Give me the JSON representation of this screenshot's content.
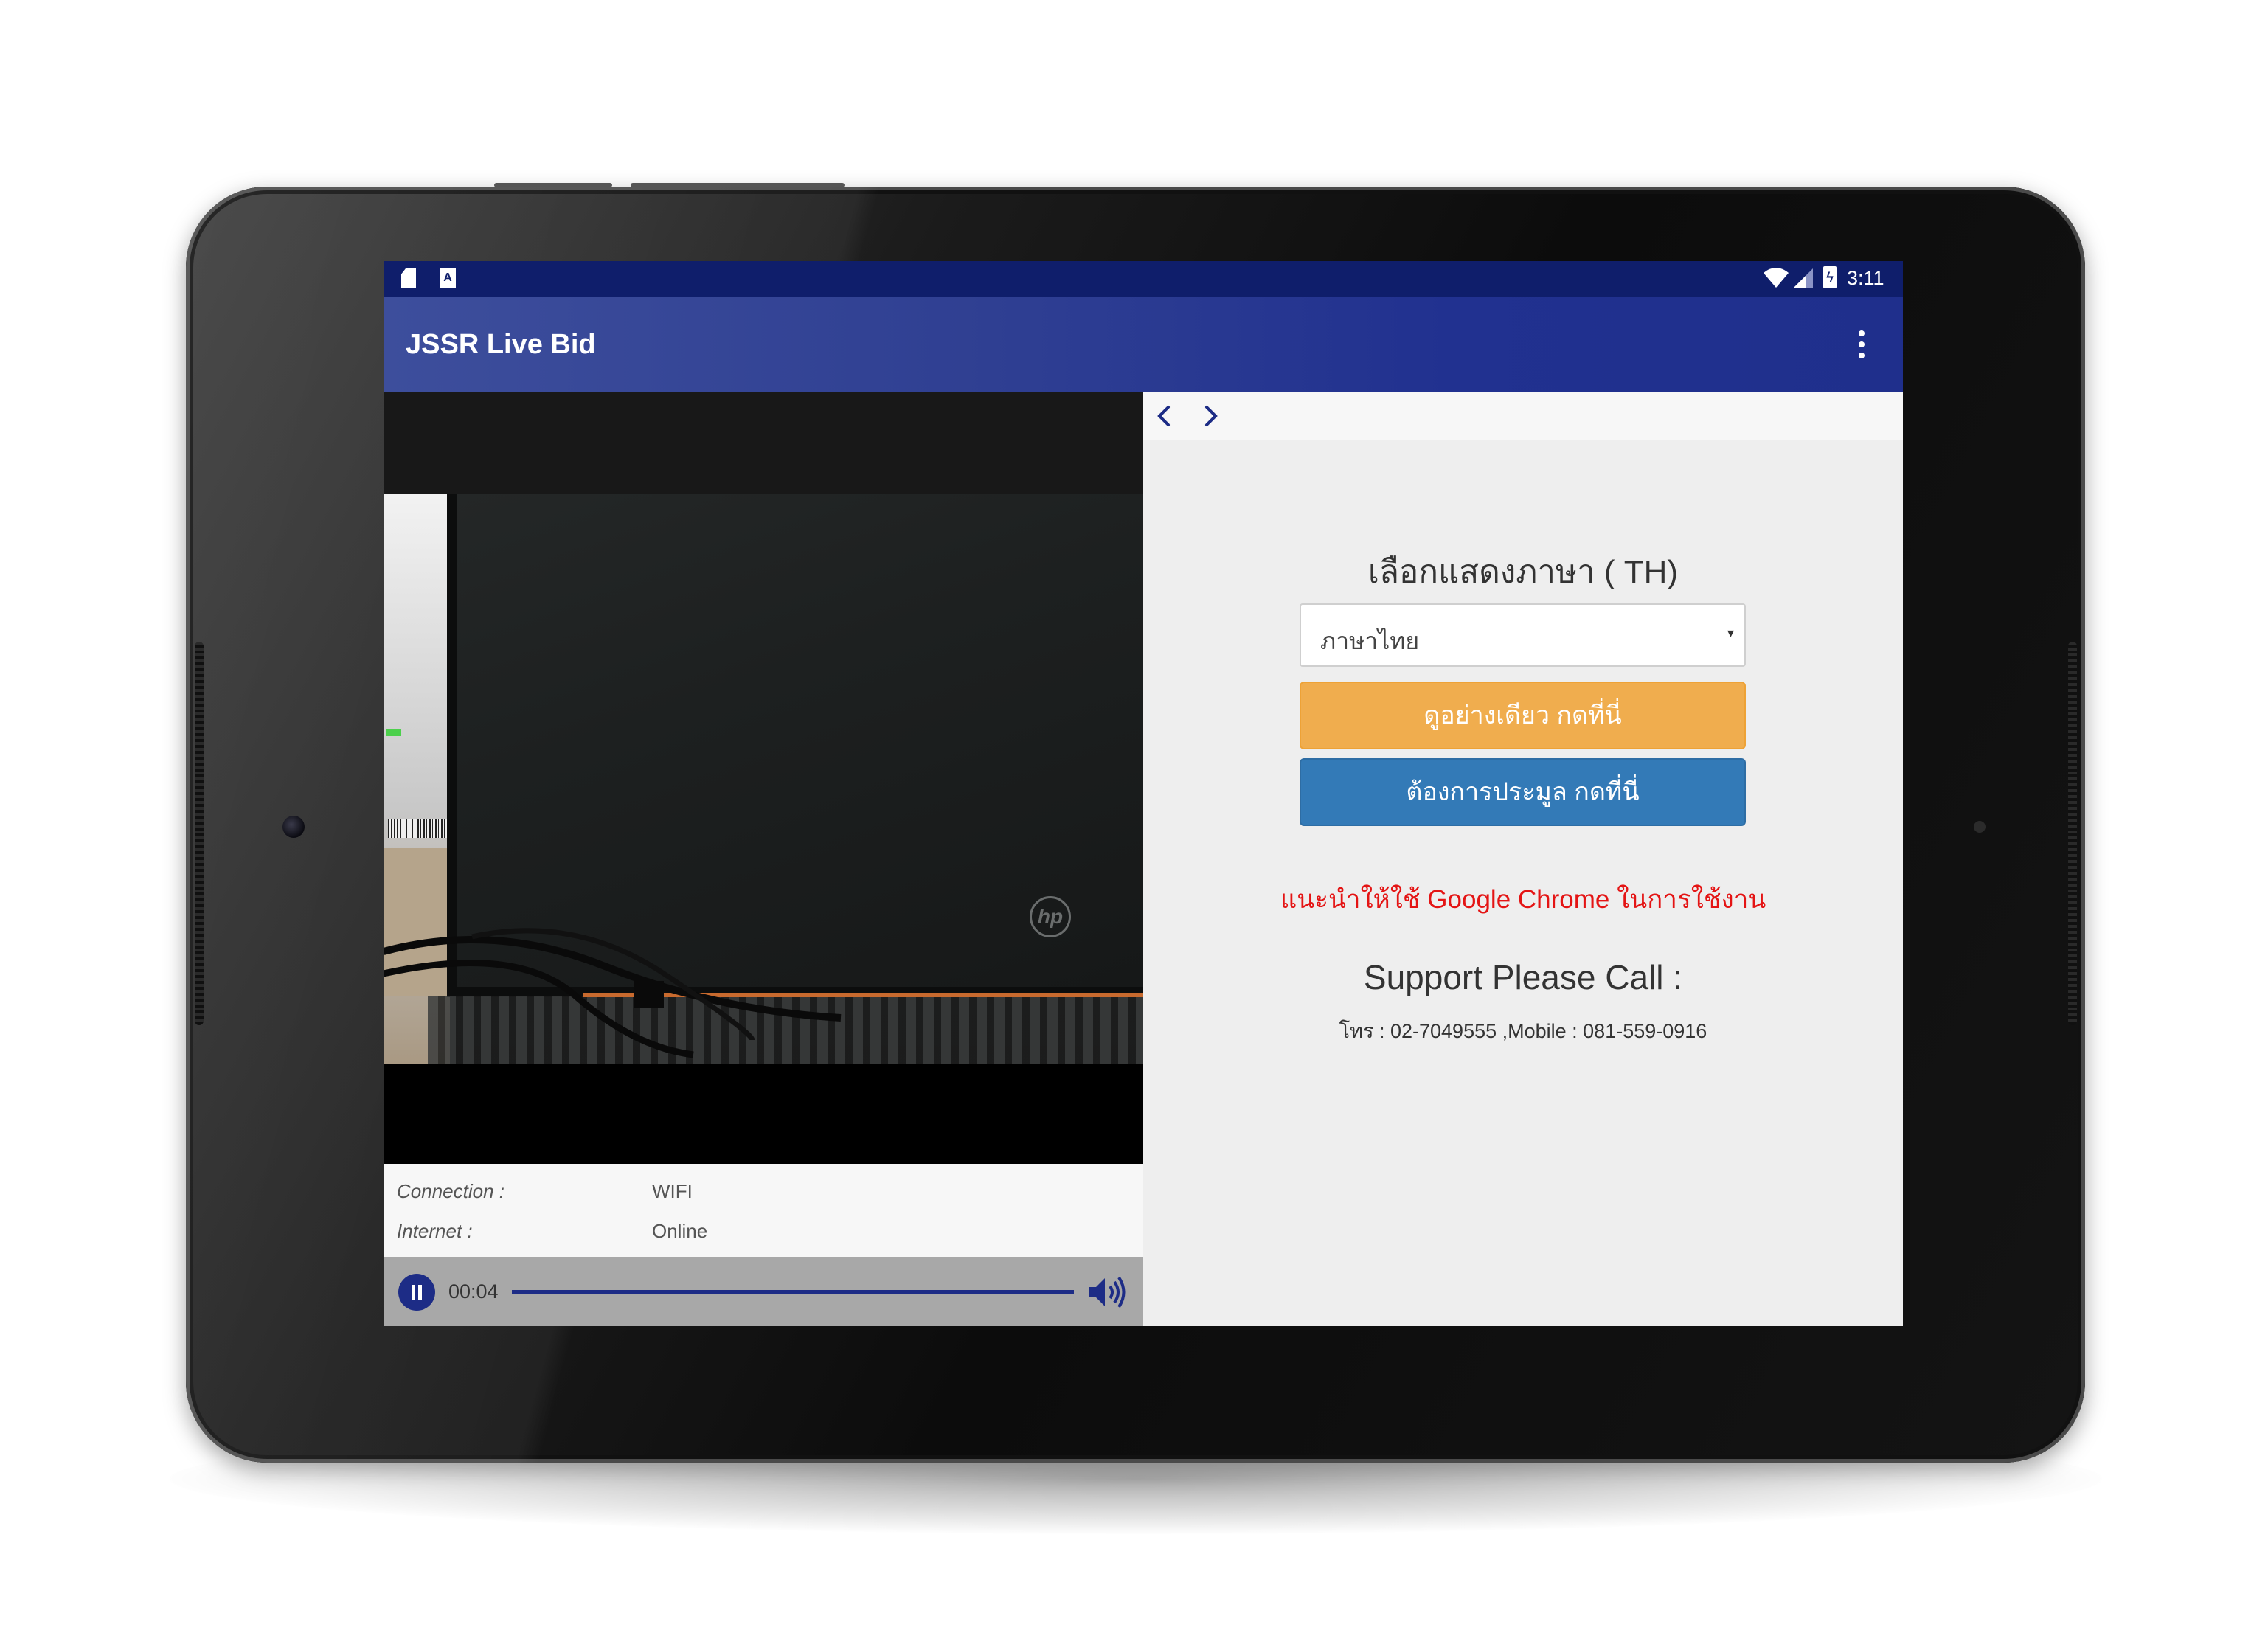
{
  "status_bar": {
    "clock": "3:11",
    "icons": [
      "sd-card-icon",
      "a-notification-icon",
      "wifi-icon",
      "cell-signal-icon",
      "battery-charging-icon"
    ],
    "notification_letter": "A"
  },
  "app_bar": {
    "title": "JSSR Live Bid",
    "menu_icon": "overflow-menu-icon",
    "color": "#1f2f8c"
  },
  "video_panel": {
    "info": {
      "connection_label": "Connection :",
      "connection_value": "WIFI",
      "internet_label": "Internet :",
      "internet_value": "Online"
    },
    "player": {
      "state": "playing",
      "pause_icon": "pause-icon",
      "elapsed": "00:04",
      "volume_icon": "volume-icon",
      "accent_color": "#1d2c86"
    },
    "video_logo_text": "hp"
  },
  "web_panel": {
    "nav": {
      "back_icon": "chevron-left-icon",
      "forward_icon": "chevron-right-icon"
    },
    "language_heading": "เลือกแสดงภาษา ( TH)",
    "language_select": {
      "value": "ภาษาไทย",
      "caret": "▾"
    },
    "view_button": {
      "label": "ดูอย่างเดียว กดที่นี่",
      "color": "#f0ad4e"
    },
    "bid_button": {
      "label": "ต้องการประมูล กดที่นี่",
      "color": "#337ab7"
    },
    "browser_notice": {
      "text": "แนะนำให้ใช้ Google Chrome ในการใช้งาน",
      "color": "#e41414"
    },
    "support_heading": "Support Please Call :",
    "support_phone": "โทร : 02-7049555 ,Mobile : 081-559-0916"
  },
  "system_nav": {
    "icons": [
      "back-triangle-icon",
      "home-circle-icon",
      "recents-square-icon"
    ]
  }
}
